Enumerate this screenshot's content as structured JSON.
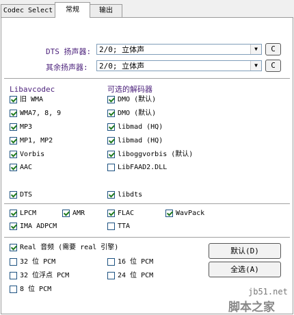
{
  "tabs": [
    "Codec Select",
    "常规",
    "输出"
  ],
  "speakers": {
    "dts_label": "DTS 扬声器:",
    "dts_value": "2/0; 立体声",
    "other_label": "其余扬声器:",
    "other_value": "2/0; 立体声",
    "config_button": "C"
  },
  "headers": {
    "left": "Libavcodec",
    "right": "可选的解码器"
  },
  "left_codecs": [
    {
      "label": "旧 WMA",
      "checked": true
    },
    {
      "label": "WMA7, 8, 9",
      "checked": true
    },
    {
      "label": "MP3",
      "checked": true
    },
    {
      "label": "MP1, MP2",
      "checked": true
    },
    {
      "label": "Vorbis",
      "checked": true
    },
    {
      "label": "AAC",
      "checked": true
    }
  ],
  "right_codecs": [
    {
      "label": "DMO (默认)",
      "checked": true
    },
    {
      "label": "DMO (默认)",
      "checked": true
    },
    {
      "label": "libmad (HQ)",
      "checked": true
    },
    {
      "label": "libmad (HQ)",
      "checked": true
    },
    {
      "label": "liboggvorbis (默认)",
      "checked": true
    },
    {
      "label": "LibFAAD2.DLL",
      "checked": false
    }
  ],
  "dts_row": {
    "left": "DTS",
    "right": "libdts"
  },
  "misc": {
    "lpcm": "LPCM",
    "amr": "AMR",
    "flac": "FLAC",
    "wavpack": "WavPack",
    "ima": "IMA ADPCM",
    "tta": "TTA"
  },
  "bottom": {
    "real": "Real 音频 (需要 real 引擎)",
    "pcm32": "32 位 PCM",
    "pcm16": "16 位 PCM",
    "pcm32f": "32 位浮点 PCM",
    "pcm24": "24 位 PCM",
    "pcm8": "8 位 PCM"
  },
  "buttons": {
    "default": "默认(D)",
    "select_all": "全选(A)"
  },
  "watermark": {
    "site": "jb51.net",
    "brand": "脚本之家"
  }
}
